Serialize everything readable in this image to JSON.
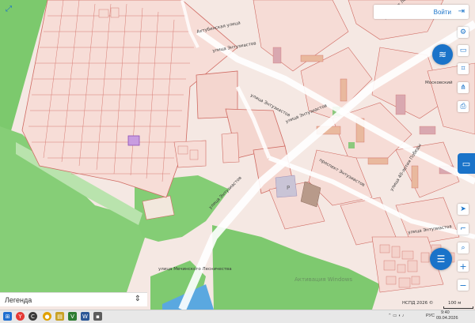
{
  "map": {
    "streets": [
      "Ахтубинская улица",
      "улица Энтузиастов",
      "улица Энтузиастов",
      "улица Энтузиастов",
      "Проспект Ленинградский",
      "проспект Энтузиастов",
      "улица 40-летия Победы",
      "улица Энтузиастов",
      "улица Мечинского Лесничества",
      "улица Энтузиастов",
      "Московский"
    ],
    "parcel_label": "Р",
    "watermark": "Активация Windows",
    "scale_label": "100 м",
    "attribution": "НСПД 2026 ©"
  },
  "login": {
    "label": "Войти",
    "icon": "login-arrow-icon"
  },
  "toolbar": {
    "icons": [
      "layers-icon",
      "map-icon",
      "selection-icon",
      "share-icon",
      "print-icon"
    ]
  },
  "side": {
    "icons": [
      "cadastre-panel-icon",
      "locate-icon",
      "ruler-icon",
      "search-icon",
      "zoom-in-icon",
      "zoom-out-icon",
      "chat-icon"
    ]
  },
  "legend": {
    "label": "Легенда"
  },
  "taskbar": {
    "lang": "РУС",
    "time": "9:40",
    "date": "09.04.2026"
  },
  "colors": {
    "parcel_stroke": "#cf6a62",
    "parcel_fill": "#f6dcd6",
    "forest": "#7bc96c",
    "highlight": "#b98ad6",
    "accent": "#1a73c9"
  }
}
